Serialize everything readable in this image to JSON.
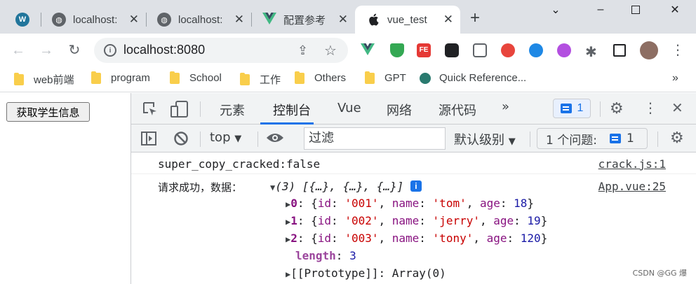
{
  "browser": {
    "tabs": [
      {
        "title": "localhost:",
        "favicon": "wordpress-icon"
      },
      {
        "title": "localhost:",
        "favicon": "globe-icon"
      },
      {
        "title": "localhost:",
        "favicon": "globe-icon"
      },
      {
        "title": "配置参考",
        "favicon": "vue-icon"
      },
      {
        "title": "vue_test",
        "favicon": "apple-icon"
      }
    ],
    "url": "localhost:8080"
  },
  "bookmarks": [
    "web前端",
    "program",
    "School",
    "工作",
    "Others",
    "GPT",
    "Quick Reference...",
    "»"
  ],
  "page": {
    "fetch_button": "获取学生信息"
  },
  "devtools": {
    "tabs": [
      "元素",
      "控制台",
      "Vue",
      "网络",
      "源代码",
      "»"
    ],
    "message_count": "1",
    "context": "top",
    "filter_placeholder": "过滤",
    "level": "默认级别",
    "issues_label": "1 个问题:",
    "issues_count": "1"
  },
  "console": {
    "line1": "super_copy_cracked:false",
    "line1_src": "crack.js:1",
    "line2_label": "请求成功，数据：",
    "line2_summary": "(3) [{…}, {…}, {…}]",
    "line2_src": "App.vue:25",
    "items": [
      {
        "index": "0",
        "id": "'001'",
        "name": "'tom'",
        "age": "18"
      },
      {
        "index": "1",
        "id": "'002'",
        "name": "'jerry'",
        "age": "19"
      },
      {
        "index": "2",
        "id": "'003'",
        "name": "'tony'",
        "age": "120"
      }
    ],
    "length_label": "length",
    "length_value": "3",
    "prototype": "[[Prototype]]: Array(0)"
  },
  "watermark": "CSDN @GG 爆",
  "colors": {
    "accent": "#1a73e8",
    "string": "#c80000",
    "number": "#1a1aa6",
    "key": "#881280"
  }
}
